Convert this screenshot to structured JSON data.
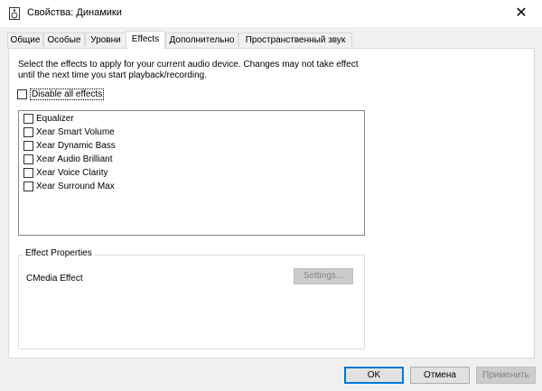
{
  "window": {
    "title": "Свойства: Динамики",
    "close_glyph": "✕"
  },
  "tabs": [
    {
      "label": "Общие"
    },
    {
      "label": "Особые"
    },
    {
      "label": "Уровни"
    },
    {
      "label": "Effects",
      "active": true
    },
    {
      "label": "Дополнительно"
    },
    {
      "label": "Пространственный звук"
    }
  ],
  "effects_tab": {
    "description_line1": "Select the effects to apply for your current audio device. Changes may not take effect",
    "description_line2": "until the next time you start playback/recording.",
    "disable_all": {
      "label": "Disable all effects",
      "checked": false
    },
    "effects": [
      {
        "label": "Equalizer",
        "checked": false
      },
      {
        "label": "Xear Smart Volume",
        "checked": false
      },
      {
        "label": "Xear Dynamic Bass",
        "checked": false
      },
      {
        "label": "Xear Audio Brilliant",
        "checked": false
      },
      {
        "label": "Xear Voice Clarity",
        "checked": false
      },
      {
        "label": "Xear Surround Max",
        "checked": false
      }
    ],
    "properties": {
      "legend": "Effect Properties",
      "name": "CMedia Effect",
      "settings_label": "Settings..."
    }
  },
  "footer": {
    "ok_label": "OK",
    "cancel_label": "Отмена",
    "apply_label": "Применить"
  },
  "colors": {
    "accent": "#0078d7",
    "disabled_button": "#cccccc",
    "disabled_text": "#838383"
  }
}
